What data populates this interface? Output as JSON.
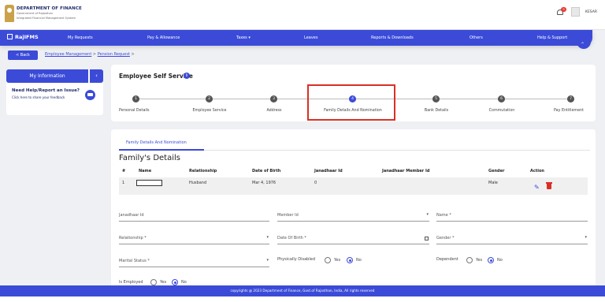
{
  "header": {
    "brand_title": "DEPARTMENT OF FINANCE",
    "brand_sub": "Government of Rajasthan",
    "brand_sub2": "Integrated Financial Management System",
    "notification_count": "9",
    "username": "KESAR"
  },
  "nav": {
    "logo": "RajIFMS",
    "items": [
      "My Requests",
      "Pay & Allowance",
      "Taxes ▾",
      "Leaves",
      "Reports & Downloads",
      "Others",
      "Help & Support"
    ],
    "collapse": "⌃"
  },
  "breadcrumb": {
    "back": "< Back",
    "item1": "Employee Management",
    "sep": ">",
    "item2": "Pension Request",
    "sep2": ">"
  },
  "sidebar": {
    "my_information": "My Information",
    "toggle": "‹",
    "help_title": "Need Help/Report an Issue?",
    "help_sub": "Click here to share your feedback"
  },
  "ess": {
    "title": "Employee Self Service",
    "info": "i",
    "steps": [
      {
        "num": "1",
        "label": "Personal Details"
      },
      {
        "num": "2",
        "label": "Employee Service"
      },
      {
        "num": "3",
        "label": "Address"
      },
      {
        "num": "4",
        "label": "Family Details And Nomination"
      },
      {
        "num": "5",
        "label": "Bank Details"
      },
      {
        "num": "6",
        "label": "Commutation"
      },
      {
        "num": "7",
        "label": "Pay Entitlement"
      }
    ],
    "active_step": 4
  },
  "family": {
    "tab": "Family Details And Nomination",
    "heading": "Family's Details",
    "columns": [
      "#",
      "Name",
      "Relationship",
      "Date of Birth",
      "Janadhaar Id",
      "Janadhaar Member Id",
      "Gender",
      "Action"
    ],
    "rows": [
      {
        "num": "1",
        "name": "",
        "relationship": "Husband",
        "dob": "Mar 4, 1976",
        "janadhaar": "0",
        "member_id": "",
        "gender": "Male"
      }
    ]
  },
  "form": {
    "janadhaar_id": "Janadhaar Id",
    "member_id": "Member Id",
    "name": "Name *",
    "relationship": "Relationship *",
    "dob": "Date Of Birth *",
    "gender": "Gender *",
    "marital_status": "Marital Status *",
    "physically_disabled": "Physically Disabled",
    "dependent": "Dependent",
    "is_employed": "Is Employed",
    "yes": "Yes",
    "no": "No",
    "dropdown_arrow": "▾"
  },
  "footer": {
    "text": "copyrights @ 2023 Department of Finance, Govt.of Rajasthan, India, All rights reserved"
  },
  "colors": {
    "primary": "#3b4bd8",
    "highlight": "#d93025"
  }
}
